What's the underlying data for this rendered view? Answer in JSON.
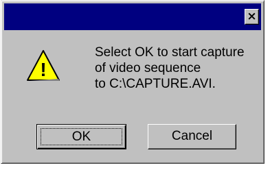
{
  "titlebar": {
    "title": "",
    "close_label": "✕"
  },
  "icon": {
    "name": "warning-icon",
    "glyph": "!",
    "fill": "#ffff00"
  },
  "message": {
    "lines": [
      "Select OK to start capture",
      "of video sequence",
      "to C:\\CAPTURE.AVI."
    ]
  },
  "buttons": {
    "ok_label": "OK",
    "cancel_label": "Cancel"
  },
  "colors": {
    "titlebar": "#000080",
    "face": "#c0c0c0"
  }
}
